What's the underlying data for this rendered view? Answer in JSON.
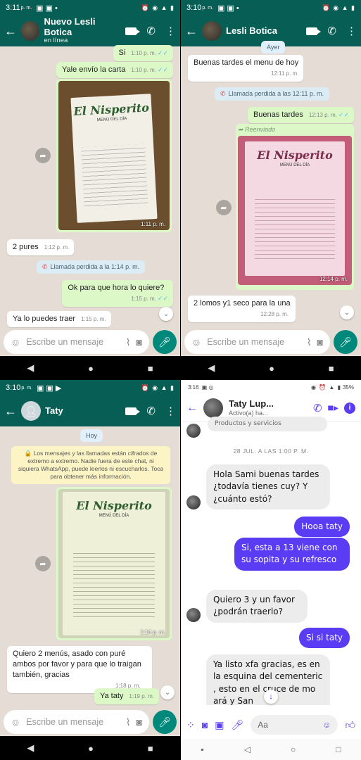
{
  "panel1": {
    "status_time": "3:11",
    "status_suffix": "p. m.",
    "contact_name": "Nuevo Lesli Botica",
    "contact_status": "en línea",
    "messages": [
      {
        "text": "Si",
        "time": "1:10 p. m."
      },
      {
        "text": "Yale envío la carta",
        "time": "1:10 p. m."
      },
      {
        "image_time": "1:11 p. m."
      },
      {
        "text": "2 pures",
        "time": "1:12 p. m."
      },
      {
        "system": "Llamada perdida a la 1:14 p. m."
      },
      {
        "text": "Ok para que hora lo quiere?",
        "time": "1:15 p. m."
      },
      {
        "text": "Ya lo puedes traer",
        "time": "1:15 p. m."
      }
    ],
    "composer_placeholder": "Escribe un mensaje"
  },
  "panel2": {
    "status_time": "3:10",
    "status_suffix": "p. m.",
    "contact_name": "Lesli Botica",
    "day_chip": "Ayer",
    "messages": [
      {
        "text": "Buenas tardes el menu de hoy",
        "time": "12:11 p. m."
      },
      {
        "system": "Llamada perdida a las 12:11 p. m."
      },
      {
        "text": "Buenas tardes",
        "time": "12:13 p. m."
      },
      {
        "forwarded_label": "Reenviado",
        "image_time": "12:14 p. m."
      },
      {
        "text": "2 lomos y1 seco para la una",
        "time": "12:28 p. m."
      }
    ],
    "composer_placeholder": "Escribe un mensaje"
  },
  "panel3": {
    "status_time": "3:10",
    "status_suffix": "p. m.",
    "contact_name": "Taty",
    "day_chip": "Hoy",
    "encryption_notice": "🔒 Los mensajes y las llamadas están cifrados de extremo a extremo. Nadie fuera de este chat, ni siquiera WhatsApp, puede leerlos ni escucharlos. Toca para obtener más información.",
    "messages": [
      {
        "image_time": "1:14 p. m."
      },
      {
        "text": "Quiero 2 menús,  asado con puré ambos por favor y para que  lo traigan también, gracias",
        "time": "1:18 p. m."
      },
      {
        "text": "Ya taty",
        "time": "1:19 p. m."
      }
    ],
    "composer_placeholder": "Escribe un mensaje"
  },
  "menu_photo": {
    "title": "El Nisperito",
    "subtitle": "MENÚ DEL DÍA"
  },
  "panel4": {
    "status_time": "3:16",
    "battery": "35%",
    "contact_name": "Taty Lup...",
    "contact_status": "Activo(a) ha...",
    "top_cut": "Productos y servicios",
    "date_divider": "28 JUL. A LAS 1:00 P. M.",
    "messages": [
      {
        "from": "them",
        "text": "Hola Sami buenas tardes ¿todavía tienes cuy? Y ¿cuánto  estó?"
      },
      {
        "from": "me",
        "text": "Hooa taty"
      },
      {
        "from": "me",
        "text": "Si, esta a 13 viene con su sopita y su refresco"
      },
      {
        "from": "them",
        "text": "Quiero 3 y un favor ¿podrán traerlo?"
      },
      {
        "from": "me",
        "text": "Si si taty"
      },
      {
        "from": "them",
        "text": "Ya listo xfa gracias, es en la esquina del cementeric , esto en el cruce de mo ará  y San"
      }
    ],
    "composer_placeholder": "Aa"
  },
  "colors": {
    "whatsapp_header": "#075e54",
    "outgoing": "#dcf8c6",
    "messenger_accent": "#5b3cf5"
  }
}
